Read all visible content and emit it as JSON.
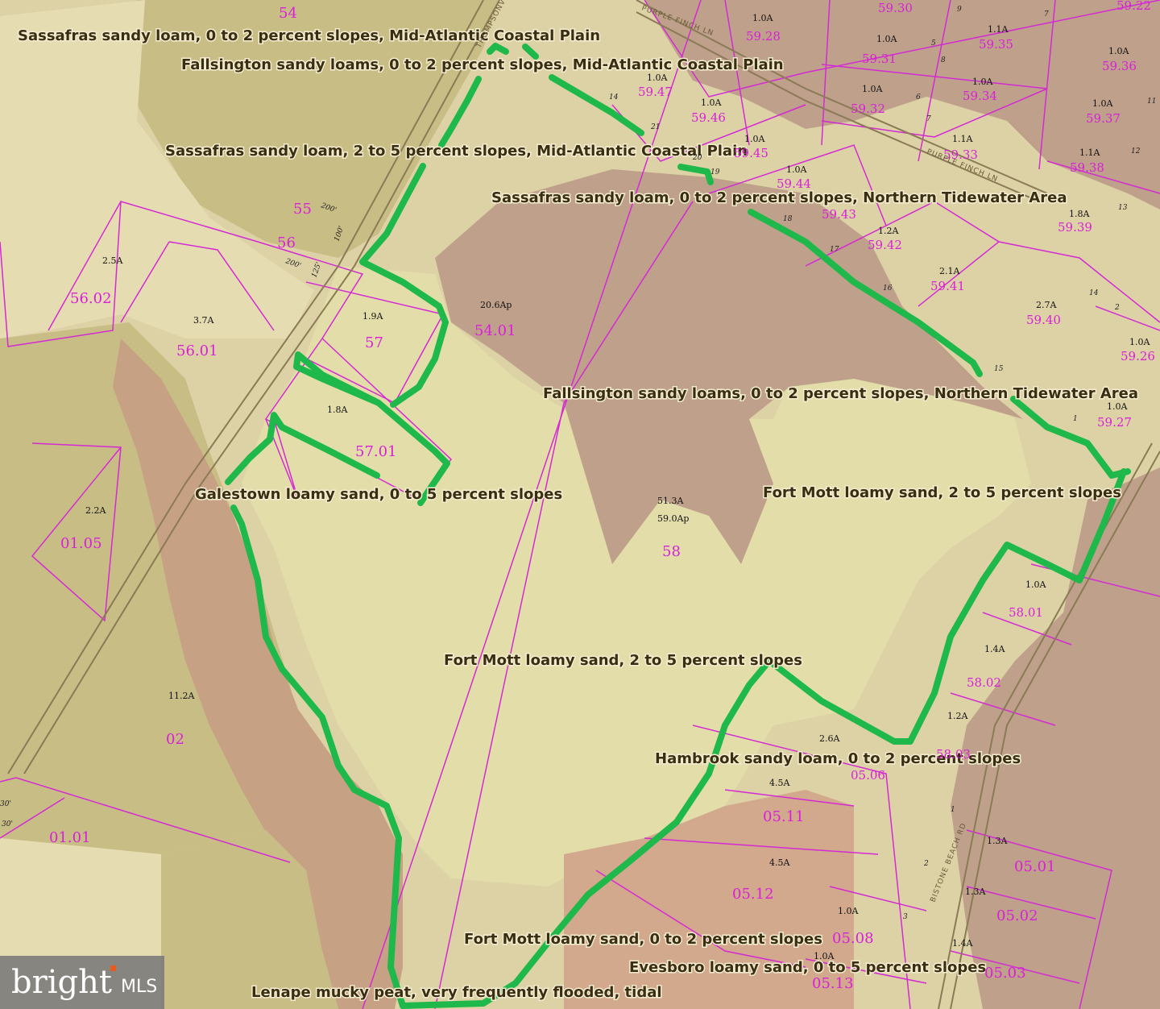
{
  "map": {
    "colors": {
      "olive": "#c9bd86",
      "tan": "#ddd2a6",
      "cream": "#e6dcb2",
      "pale_yellow": "#e3ddaa",
      "brown": "#bfa08a",
      "salmon": "#d2a98d",
      "river_band": "#c7a184",
      "parcel_line": "#d42ad4",
      "boundary": "#1fb84a"
    },
    "soil_labels": [
      "Sassafras sandy loam, 0 to 2 percent slopes, Mid-Atlantic Coastal Plain",
      "Fallsington sandy loams, 0 to 2 percent slopes, Mid-Atlantic Coastal Plain",
      "Sassafras sandy loam, 2 to 5 percent slopes, Mid-Atlantic Coastal Plain",
      "Sassafras sandy loam, 0 to 2 percent slopes, Northern Tidewater Area",
      "Fallsington sandy loams, 0 to 2 percent slopes, Northern Tidewater Area",
      "Galestown loamy sand, 0 to 5 percent slopes",
      "Fort Mott loamy sand, 2 to 5 percent slopes",
      "Fort Mott loamy sand, 2 to 5 percent slopes",
      "Hambrook sandy loam, 0 to 2 percent slopes",
      "Fort Mott loamy sand, 0 to 2 percent slopes",
      "Evesboro loamy sand, 0 to 5 percent slopes",
      "Lenape mucky peat, very frequently flooded, tidal"
    ],
    "parcels": [
      {
        "id": "54",
        "acre": ""
      },
      {
        "id": "55",
        "acre": ""
      },
      {
        "id": "56",
        "acre": ""
      },
      {
        "id": "56.02",
        "acre": "2.5A"
      },
      {
        "id": "56.01",
        "acre": "3.7A"
      },
      {
        "id": "57",
        "acre": "1.9A"
      },
      {
        "id": "57.01",
        "acre": "1.8A"
      },
      {
        "id": "54.01",
        "acre": "20.6Ap"
      },
      {
        "id": "58",
        "acre": "51.3A",
        "acre2": "59.0Ap"
      },
      {
        "id": "01.05",
        "acre": "2.2A"
      },
      {
        "id": "02",
        "acre": "11.2A"
      },
      {
        "id": "01.01",
        "acre": ""
      },
      {
        "id": "59.28",
        "acre": "1.0A"
      },
      {
        "id": "59.30",
        "acre": ""
      },
      {
        "id": "59.22",
        "acre": ""
      },
      {
        "id": "59.31",
        "acre": "1.0A"
      },
      {
        "id": "59.35",
        "acre": "1.1A"
      },
      {
        "id": "59.36",
        "acre": "1.0A"
      },
      {
        "id": "59.47",
        "acre": "1.0A"
      },
      {
        "id": "59.46",
        "acre": "1.0A"
      },
      {
        "id": "59.32",
        "acre": "1.0A"
      },
      {
        "id": "59.34",
        "acre": "1.0A"
      },
      {
        "id": "59.37",
        "acre": "1.0A"
      },
      {
        "id": "59.45",
        "acre": "1.0A"
      },
      {
        "id": "59.33",
        "acre": "1.1A"
      },
      {
        "id": "59.38",
        "acre": "1.1A"
      },
      {
        "id": "59.44",
        "acre": "1.0A"
      },
      {
        "id": "59.43",
        "acre": ""
      },
      {
        "id": "59.42",
        "acre": "1.2A"
      },
      {
        "id": "59.39",
        "acre": "1.8A"
      },
      {
        "id": "59.41",
        "acre": "2.1A"
      },
      {
        "id": "59.40",
        "acre": "2.7A"
      },
      {
        "id": "59.26",
        "acre": "1.0A"
      },
      {
        "id": "59.27",
        "acre": "1.0A"
      },
      {
        "id": "58.01",
        "acre": "1.0A"
      },
      {
        "id": "58.02",
        "acre": "1.4A"
      },
      {
        "id": "58.03",
        "acre": "1.2A"
      },
      {
        "id": "05.06",
        "acre": "2.6A"
      },
      {
        "id": "05.11",
        "acre": "4.5A"
      },
      {
        "id": "05.12",
        "acre": "4.5A"
      },
      {
        "id": "05.01",
        "acre": "1.3A"
      },
      {
        "id": "05.02",
        "acre": "1.3A"
      },
      {
        "id": "05.08",
        "acre": "1.0A"
      },
      {
        "id": "05.03",
        "acre": "1.4A"
      },
      {
        "id": "05.13",
        "acre": "1.0A"
      }
    ],
    "dimension_labels": [
      "200'",
      "100'",
      "200'",
      "125'",
      "30'",
      "30'"
    ],
    "lot_numbers": [
      "14",
      "21",
      "20",
      "19",
      "18",
      "17",
      "16",
      "15",
      "9",
      "7",
      "5",
      "8",
      "6",
      "7",
      "11",
      "12",
      "13",
      "14",
      "2",
      "1",
      "1",
      "2",
      "3"
    ],
    "road_labels": [
      "PURPLE FINCH LN",
      "PURPLE FINCH LN",
      "THOMPSONVILLE RD",
      "BISTONE BEACH RD"
    ]
  },
  "watermark": {
    "brand": "bright",
    "suffix": "MLS"
  }
}
